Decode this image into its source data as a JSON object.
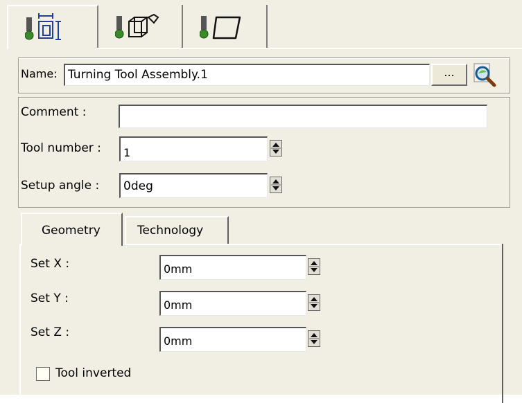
{
  "tool_tabs": [
    {
      "icon": "tool-assembly-geometry-icon"
    },
    {
      "icon": "tool-assembly-3d-icon"
    },
    {
      "icon": "tool-insert-icon"
    }
  ],
  "name": {
    "label": "Name:",
    "value": "Turning Tool Assembly.1",
    "browse_label": "...",
    "search_icon": "search-magnifier-icon"
  },
  "properties": {
    "comment_label": "Comment :",
    "comment_value": "",
    "tool_number_label": "Tool number :",
    "tool_number_value": "1",
    "setup_angle_label": "Setup angle :",
    "setup_angle_value": "0deg"
  },
  "inner_tabs": [
    {
      "label": "Geometry",
      "active": true
    },
    {
      "label": "Technology",
      "active": false
    }
  ],
  "geometry": {
    "set_x_label": "Set X :",
    "set_x_value": "0mm",
    "set_y_label": "Set Y :",
    "set_y_value": "0mm",
    "set_z_label": "Set Z :",
    "set_z_value": "0mm",
    "tool_inverted_label": "Tool inverted",
    "tool_inverted_checked": false
  },
  "colors": {
    "panel_bg": "#f1efe4",
    "icon_green": "#3a8a2a",
    "icon_blue": "#1f3f9a"
  }
}
